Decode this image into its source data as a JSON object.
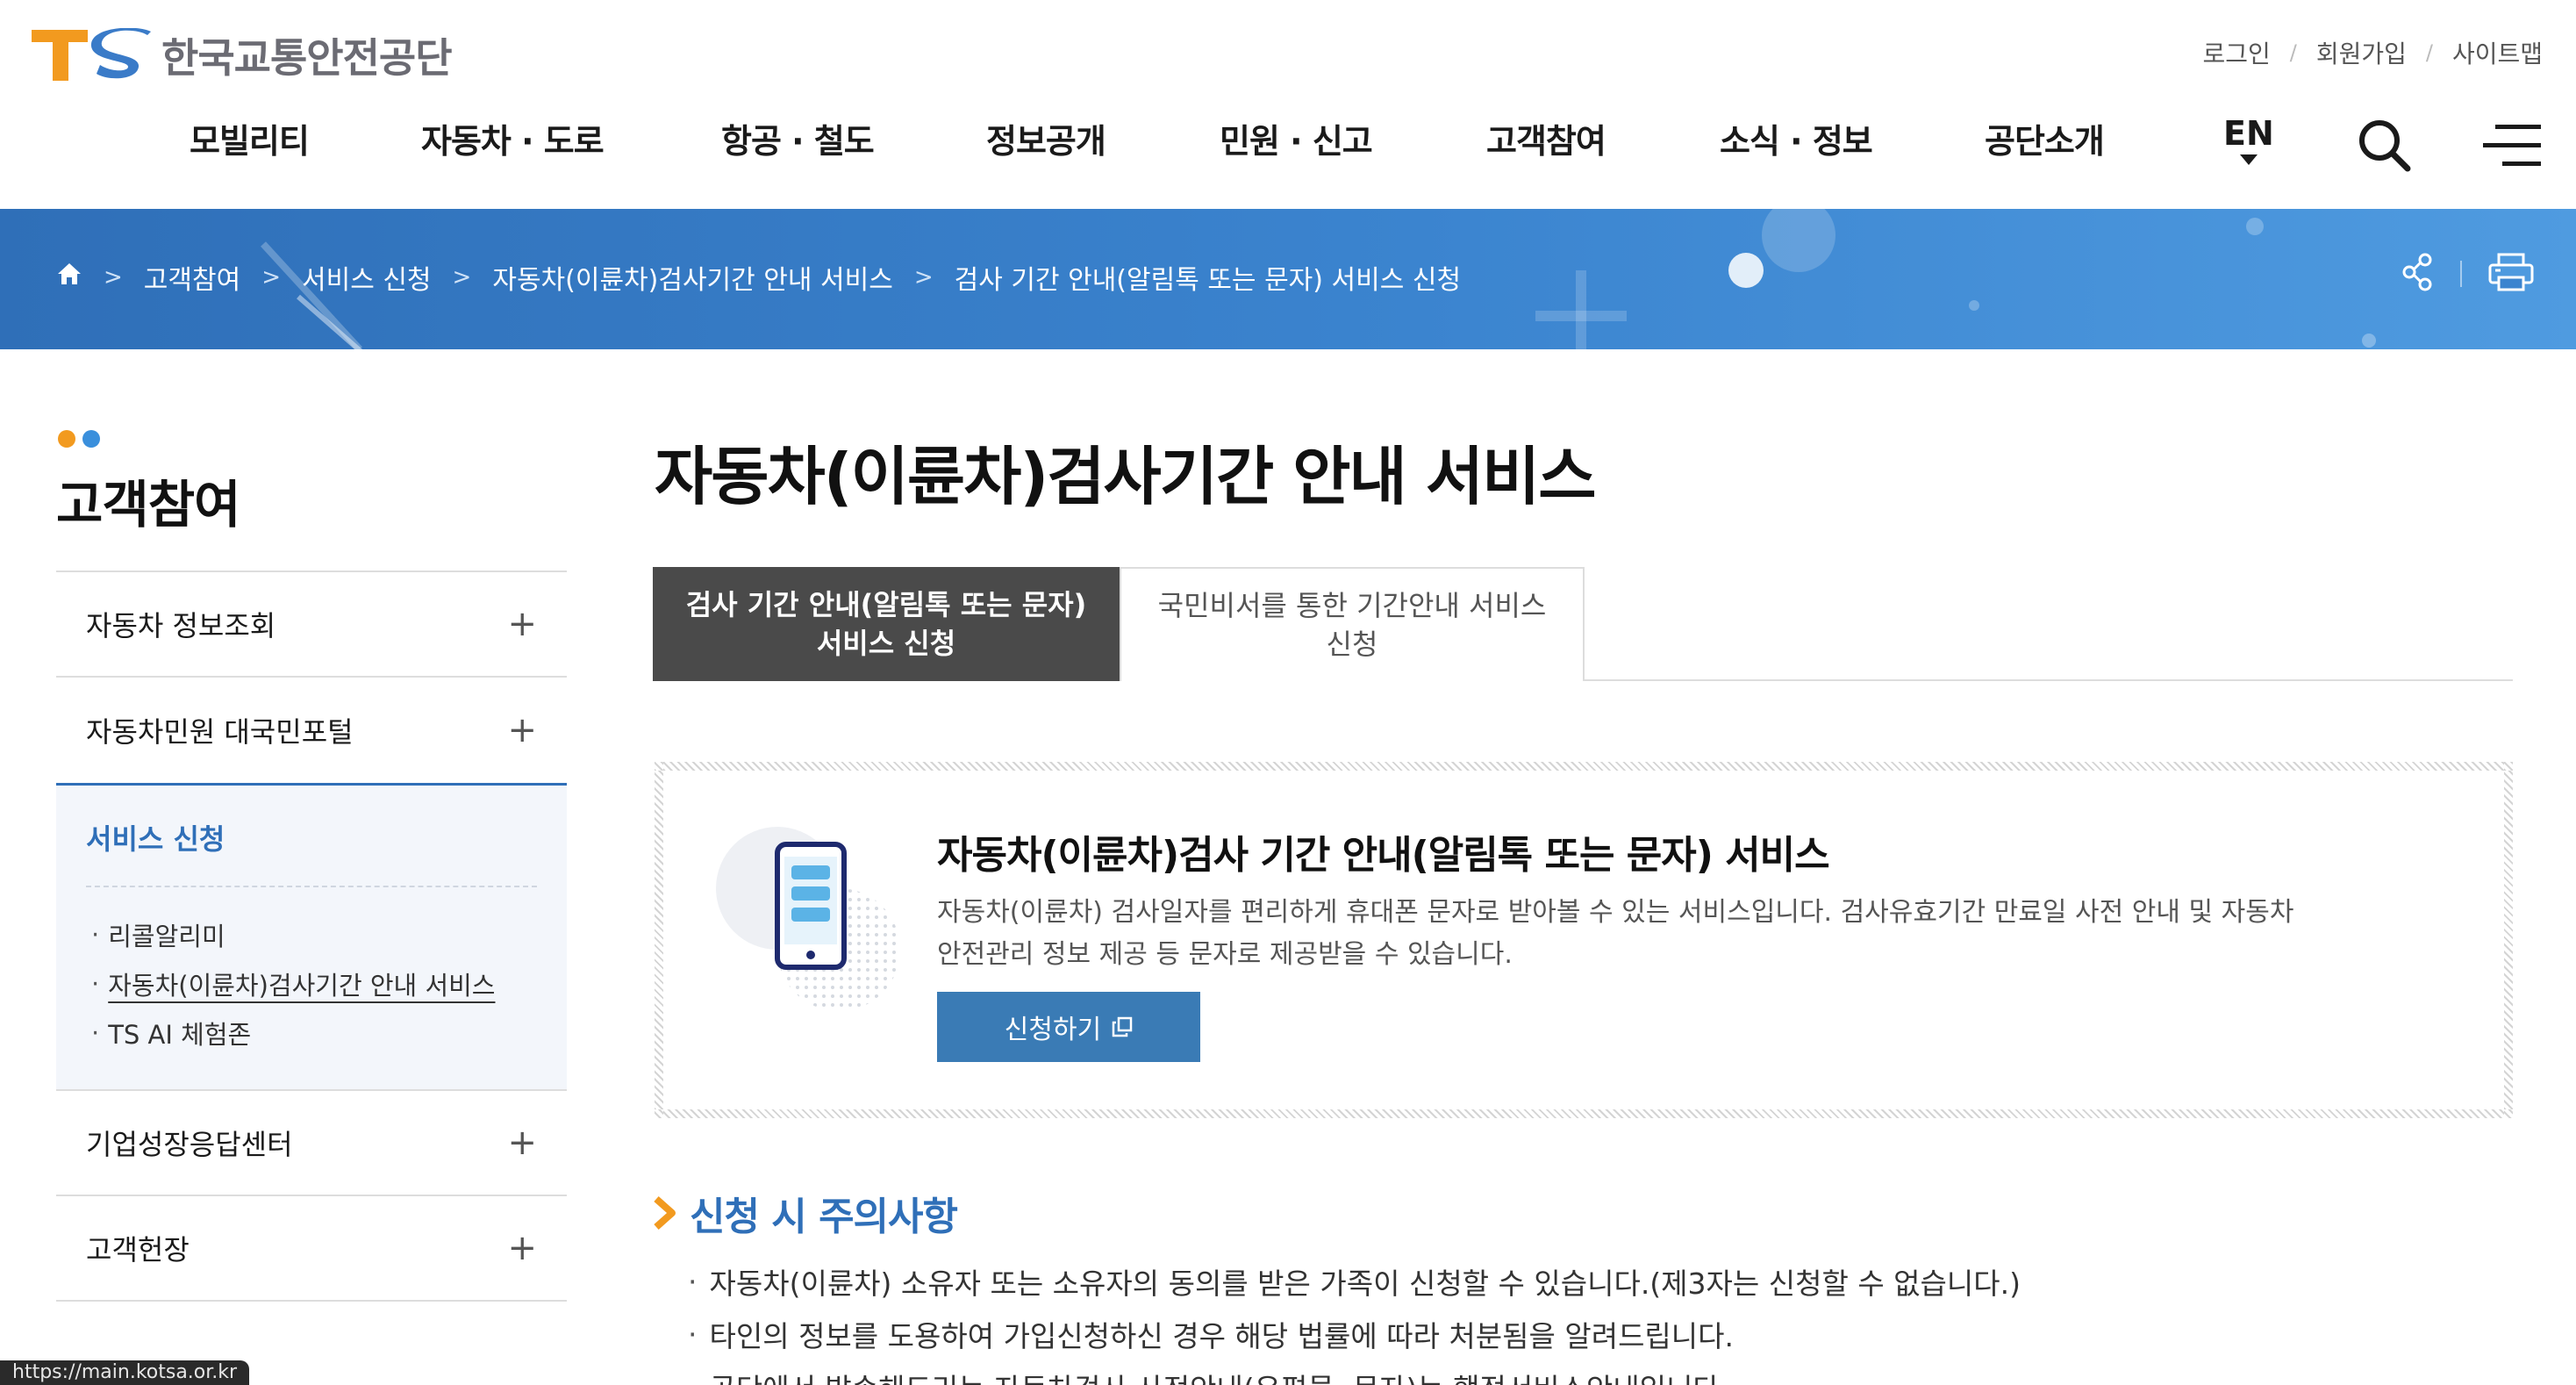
{
  "header": {
    "logo_mark": "TS",
    "logo_name": "한국교통안전공단",
    "util": [
      "로그인",
      "회원가입",
      "사이트맵"
    ],
    "gnb": [
      "모빌리티",
      "자동차 · 도로",
      "항공 · 철도",
      "정보공개",
      "민원 · 신고",
      "고객참여",
      "소식 · 정보",
      "공단소개"
    ],
    "lang": "EN"
  },
  "breadcrumb": [
    "고객참여",
    "서비스 신청",
    "자동차(이륜차)검사기간 안내 서비스",
    "검사 기간 안내(알림톡 또는 문자) 서비스 신청"
  ],
  "sidebar": {
    "title": "고객참여",
    "items": [
      {
        "label": "자동차 정보조회"
      },
      {
        "label": "자동차민원 대국민포털"
      },
      {
        "label": "서비스 신청",
        "sub": [
          "리콜알리미",
          "자동차(이륜차)검사기간 안내 서비스",
          "TS AI 체험존"
        ]
      },
      {
        "label": "기업성장응답센터"
      },
      {
        "label": "고객헌장"
      }
    ]
  },
  "main": {
    "title": "자동차(이륜차)검사기간 안내 서비스",
    "tabs": [
      {
        "line1": "검사 기간 안내(알림톡 또는 문자)",
        "line2": "서비스 신청"
      },
      {
        "line1": "국민비서를 통한 기간안내 서비스",
        "line2": "신청"
      }
    ],
    "service": {
      "title": "자동차(이륜차)검사 기간 안내(알림톡 또는 문자) 서비스",
      "desc_line1": "자동차(이륜차) 검사일자를 편리하게 휴대폰 문자로 받아볼 수 있는 서비스입니다. 검사유효기간 만료일 사전 안내 및 자동차",
      "desc_line2": "안전관리 정보 제공 등 문자로 제공받을 수 있습니다.",
      "button": "신청하기"
    },
    "notice": {
      "title": "신청 시 주의사항",
      "items": [
        "자동차(이륜차) 소유자 또는 소유자의 동의를 받은 가족이 신청할 수 있습니다.(제3자는 신청할 수 없습니다.)",
        "타인의 정보를 도용하여 가입신청하신 경우 해당 법률에 따라 처분됨을 알려드립니다.",
        "공단에서 발송해드리는 자동차검사 사전안내(우편물, 문자)는 행정서비스안내입니다."
      ]
    }
  },
  "status_url": "https://main.kotsa.or.kr",
  "colors": {
    "brand_blue": "#2f6fb8",
    "brand_orange": "#f29a1f",
    "button_blue": "#3a7bb5",
    "tab_dark": "#4a4a4a"
  },
  "icons": [
    "home-icon",
    "share-icon",
    "print-icon",
    "search-icon",
    "menu-icon",
    "phone-chat-icon",
    "new-window-icon",
    "chevron-right-icon",
    "plus-icon"
  ]
}
